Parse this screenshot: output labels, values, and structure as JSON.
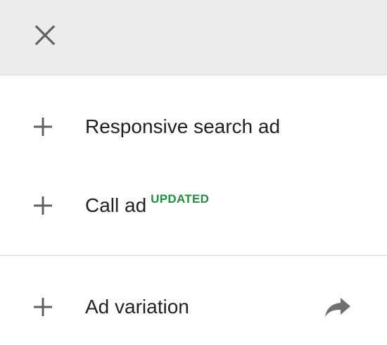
{
  "header": {
    "close_icon": "close-icon"
  },
  "menu": {
    "items": [
      {
        "label": "Responsive search ad",
        "icon": "plus-icon",
        "badge": ""
      },
      {
        "label": "Call ad",
        "icon": "plus-icon",
        "badge": "UPDATED"
      }
    ],
    "secondary": [
      {
        "label": "Ad variation",
        "icon": "plus-icon",
        "trailing_icon": "share-arrow-icon"
      }
    ]
  },
  "colors": {
    "header_bg": "#ececec",
    "badge": "#1e8e3e",
    "icon": "#616161",
    "text": "#202124"
  }
}
